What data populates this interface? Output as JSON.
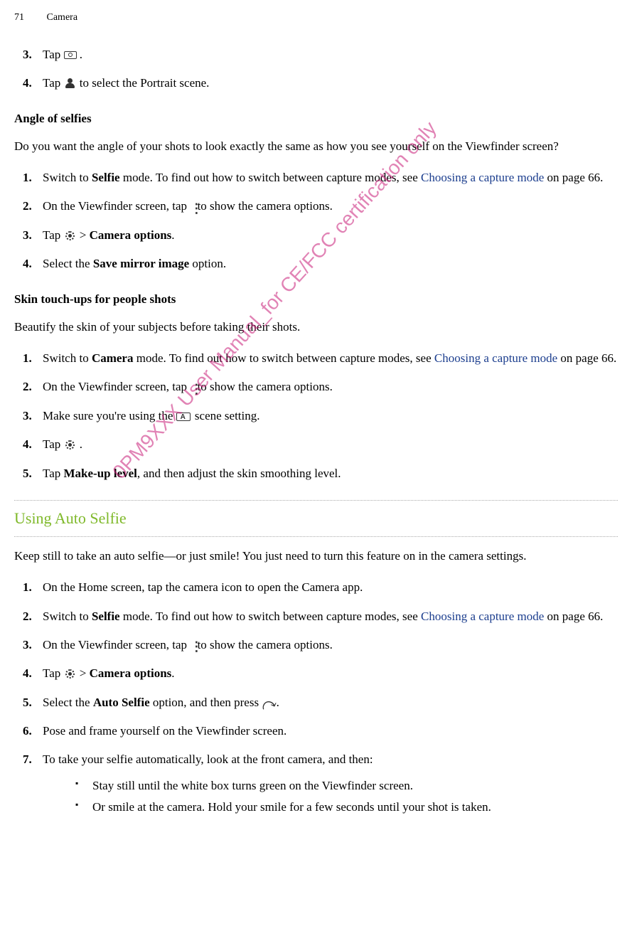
{
  "header": {
    "page_number": "71",
    "section": "Camera"
  },
  "top_steps": {
    "s3": {
      "num": "3.",
      "pre": "Tap ",
      "post": " ."
    },
    "s4": {
      "num": "4.",
      "pre": "Tap ",
      "post": " to select the Portrait scene."
    }
  },
  "angle": {
    "title": "Angle of selfies",
    "intro": "Do you want the angle of your shots to look exactly the same as how you see yourself on the Viewfinder screen?",
    "s1": {
      "num": "1.",
      "a": "Switch to ",
      "b": "Selfie",
      "c": " mode. To find out how to switch between capture modes, see ",
      "link": "Choosing a capture mode",
      "d": " on page 66."
    },
    "s2": {
      "num": "2.",
      "a": "On the Viewfinder screen, tap ",
      "b": " to show the camera options."
    },
    "s3": {
      "num": "3.",
      "a": "Tap ",
      "gt": " > ",
      "b": "Camera options",
      "c": "."
    },
    "s4": {
      "num": "4.",
      "a": "Select the ",
      "b": "Save mirror image",
      "c": " option."
    }
  },
  "skin": {
    "title": "Skin touch-ups for people shots",
    "intro": "Beautify the skin of your subjects before taking their shots.",
    "s1": {
      "num": "1.",
      "a": "Switch to ",
      "b": "Camera",
      "c": " mode. To find out how to switch between capture modes, see ",
      "link": "Choosing a capture mode",
      "d": " on page 66."
    },
    "s2": {
      "num": "2.",
      "a": "On the Viewfinder screen, tap ",
      "b": " to show the camera options."
    },
    "s3": {
      "num": "3.",
      "a": "Make sure you're using the ",
      "b": " scene setting."
    },
    "s4": {
      "num": "4.",
      "a": "Tap ",
      "b": " ."
    },
    "s5": {
      "num": "5.",
      "a": "Tap ",
      "b": "Make-up level",
      "c": ", and then adjust the skin smoothing level."
    }
  },
  "auto": {
    "title": "Using Auto Selfie",
    "intro": "Keep still to take an auto selfie—or just smile! You just need to turn this feature on in the camera settings.",
    "s1": {
      "num": "1.",
      "a": "On the Home screen, tap the camera icon to open the Camera app."
    },
    "s2": {
      "num": "2.",
      "a": "Switch to ",
      "b": "Selfie",
      "c": " mode. To find out how to switch between capture modes, see ",
      "link": "Choosing a capture mode",
      "d": " on page 66."
    },
    "s3": {
      "num": "3.",
      "a": "On the Viewfinder screen, tap ",
      "b": " to show the camera options."
    },
    "s4": {
      "num": "4.",
      "a": "Tap ",
      "gt": " > ",
      "b": "Camera options",
      "c": "."
    },
    "s5": {
      "num": "5.",
      "a": "Select the ",
      "b": "Auto Selfie",
      "c": " option, and then press ",
      "d": " ."
    },
    "s6": {
      "num": "6.",
      "a": "Pose and frame yourself on the Viewfinder screen."
    },
    "s7": {
      "num": "7.",
      "a": "To take your selfie automatically, look at the front camera, and then:"
    },
    "b1": "Stay still until the white box turns green on the Viewfinder screen.",
    "b2": "Or smile at the camera. Hold your smile for a few seconds until your shot is taken."
  },
  "watermark": "0PM9XXX User Manual_for CE/FCC certification only"
}
